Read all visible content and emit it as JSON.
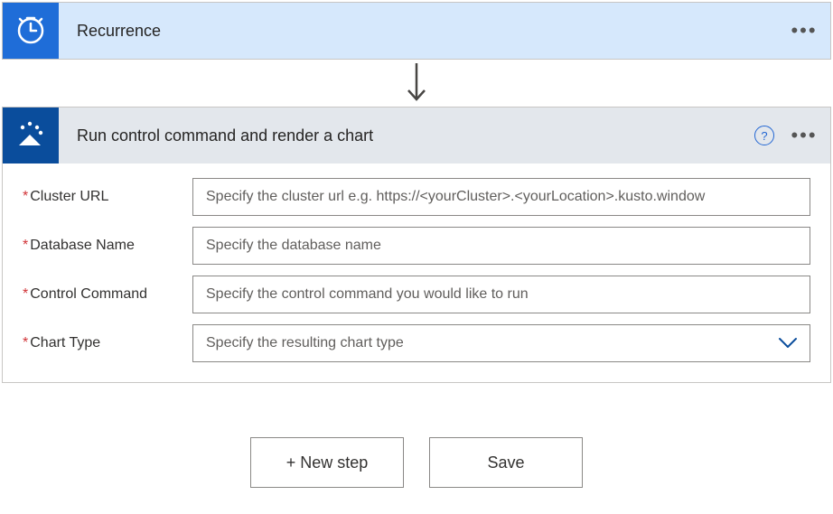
{
  "steps": {
    "recurrence": {
      "title": "Recurrence"
    },
    "action": {
      "title": "Run control command and render a chart"
    }
  },
  "fields": {
    "clusterUrl": {
      "label": "Cluster URL",
      "placeholder": "Specify the cluster url e.g. https://<yourCluster>.<yourLocation>.kusto.window"
    },
    "databaseName": {
      "label": "Database Name",
      "placeholder": "Specify the database name"
    },
    "controlCommand": {
      "label": "Control Command",
      "placeholder": "Specify the control command you would like to run"
    },
    "chartType": {
      "label": "Chart Type",
      "placeholder": "Specify the resulting chart type"
    }
  },
  "buttons": {
    "newStep": "+ New step",
    "save": "Save"
  },
  "help": "?"
}
